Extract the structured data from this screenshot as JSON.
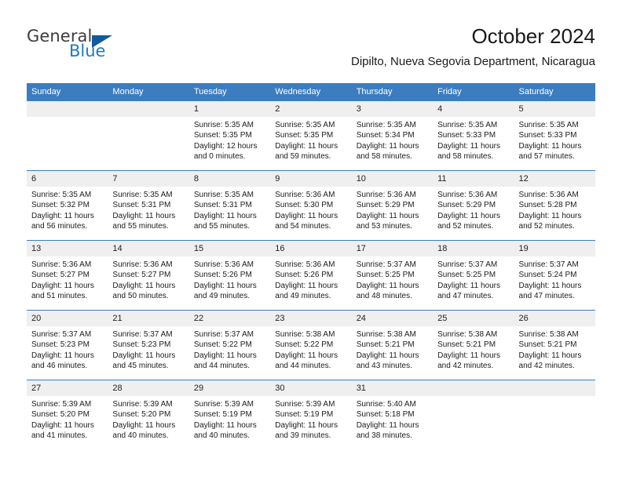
{
  "logo": {
    "word_one": "General",
    "word_two": "Blue",
    "triangle": "triangle-mark"
  },
  "header": {
    "title": "October 2024",
    "subtitle": "Dipilto, Nueva Segovia Department, Nicaragua"
  },
  "colors": {
    "header_blue": "#3c7dc0",
    "logo_blue": "#1f7ac0",
    "logo_triangle": "#125a9e",
    "daynum_band": "#efefef"
  },
  "weekday_headers": [
    "Sunday",
    "Monday",
    "Tuesday",
    "Wednesday",
    "Thursday",
    "Friday",
    "Saturday"
  ],
  "weeks": [
    [
      {
        "day": "",
        "sunrise": "",
        "sunset": "",
        "daylight": "",
        "blank": true
      },
      {
        "day": "",
        "sunrise": "",
        "sunset": "",
        "daylight": "",
        "blank": true
      },
      {
        "day": "1",
        "sunrise": "Sunrise: 5:35 AM",
        "sunset": "Sunset: 5:35 PM",
        "daylight": "Daylight: 12 hours and 0 minutes."
      },
      {
        "day": "2",
        "sunrise": "Sunrise: 5:35 AM",
        "sunset": "Sunset: 5:35 PM",
        "daylight": "Daylight: 11 hours and 59 minutes."
      },
      {
        "day": "3",
        "sunrise": "Sunrise: 5:35 AM",
        "sunset": "Sunset: 5:34 PM",
        "daylight": "Daylight: 11 hours and 58 minutes."
      },
      {
        "day": "4",
        "sunrise": "Sunrise: 5:35 AM",
        "sunset": "Sunset: 5:33 PM",
        "daylight": "Daylight: 11 hours and 58 minutes."
      },
      {
        "day": "5",
        "sunrise": "Sunrise: 5:35 AM",
        "sunset": "Sunset: 5:33 PM",
        "daylight": "Daylight: 11 hours and 57 minutes."
      }
    ],
    [
      {
        "day": "6",
        "sunrise": "Sunrise: 5:35 AM",
        "sunset": "Sunset: 5:32 PM",
        "daylight": "Daylight: 11 hours and 56 minutes."
      },
      {
        "day": "7",
        "sunrise": "Sunrise: 5:35 AM",
        "sunset": "Sunset: 5:31 PM",
        "daylight": "Daylight: 11 hours and 55 minutes."
      },
      {
        "day": "8",
        "sunrise": "Sunrise: 5:35 AM",
        "sunset": "Sunset: 5:31 PM",
        "daylight": "Daylight: 11 hours and 55 minutes."
      },
      {
        "day": "9",
        "sunrise": "Sunrise: 5:36 AM",
        "sunset": "Sunset: 5:30 PM",
        "daylight": "Daylight: 11 hours and 54 minutes."
      },
      {
        "day": "10",
        "sunrise": "Sunrise: 5:36 AM",
        "sunset": "Sunset: 5:29 PM",
        "daylight": "Daylight: 11 hours and 53 minutes."
      },
      {
        "day": "11",
        "sunrise": "Sunrise: 5:36 AM",
        "sunset": "Sunset: 5:29 PM",
        "daylight": "Daylight: 11 hours and 52 minutes."
      },
      {
        "day": "12",
        "sunrise": "Sunrise: 5:36 AM",
        "sunset": "Sunset: 5:28 PM",
        "daylight": "Daylight: 11 hours and 52 minutes."
      }
    ],
    [
      {
        "day": "13",
        "sunrise": "Sunrise: 5:36 AM",
        "sunset": "Sunset: 5:27 PM",
        "daylight": "Daylight: 11 hours and 51 minutes."
      },
      {
        "day": "14",
        "sunrise": "Sunrise: 5:36 AM",
        "sunset": "Sunset: 5:27 PM",
        "daylight": "Daylight: 11 hours and 50 minutes."
      },
      {
        "day": "15",
        "sunrise": "Sunrise: 5:36 AM",
        "sunset": "Sunset: 5:26 PM",
        "daylight": "Daylight: 11 hours and 49 minutes."
      },
      {
        "day": "16",
        "sunrise": "Sunrise: 5:36 AM",
        "sunset": "Sunset: 5:26 PM",
        "daylight": "Daylight: 11 hours and 49 minutes."
      },
      {
        "day": "17",
        "sunrise": "Sunrise: 5:37 AM",
        "sunset": "Sunset: 5:25 PM",
        "daylight": "Daylight: 11 hours and 48 minutes."
      },
      {
        "day": "18",
        "sunrise": "Sunrise: 5:37 AM",
        "sunset": "Sunset: 5:25 PM",
        "daylight": "Daylight: 11 hours and 47 minutes."
      },
      {
        "day": "19",
        "sunrise": "Sunrise: 5:37 AM",
        "sunset": "Sunset: 5:24 PM",
        "daylight": "Daylight: 11 hours and 47 minutes."
      }
    ],
    [
      {
        "day": "20",
        "sunrise": "Sunrise: 5:37 AM",
        "sunset": "Sunset: 5:23 PM",
        "daylight": "Daylight: 11 hours and 46 minutes."
      },
      {
        "day": "21",
        "sunrise": "Sunrise: 5:37 AM",
        "sunset": "Sunset: 5:23 PM",
        "daylight": "Daylight: 11 hours and 45 minutes."
      },
      {
        "day": "22",
        "sunrise": "Sunrise: 5:37 AM",
        "sunset": "Sunset: 5:22 PM",
        "daylight": "Daylight: 11 hours and 44 minutes."
      },
      {
        "day": "23",
        "sunrise": "Sunrise: 5:38 AM",
        "sunset": "Sunset: 5:22 PM",
        "daylight": "Daylight: 11 hours and 44 minutes."
      },
      {
        "day": "24",
        "sunrise": "Sunrise: 5:38 AM",
        "sunset": "Sunset: 5:21 PM",
        "daylight": "Daylight: 11 hours and 43 minutes."
      },
      {
        "day": "25",
        "sunrise": "Sunrise: 5:38 AM",
        "sunset": "Sunset: 5:21 PM",
        "daylight": "Daylight: 11 hours and 42 minutes."
      },
      {
        "day": "26",
        "sunrise": "Sunrise: 5:38 AM",
        "sunset": "Sunset: 5:21 PM",
        "daylight": "Daylight: 11 hours and 42 minutes."
      }
    ],
    [
      {
        "day": "27",
        "sunrise": "Sunrise: 5:39 AM",
        "sunset": "Sunset: 5:20 PM",
        "daylight": "Daylight: 11 hours and 41 minutes."
      },
      {
        "day": "28",
        "sunrise": "Sunrise: 5:39 AM",
        "sunset": "Sunset: 5:20 PM",
        "daylight": "Daylight: 11 hours and 40 minutes."
      },
      {
        "day": "29",
        "sunrise": "Sunrise: 5:39 AM",
        "sunset": "Sunset: 5:19 PM",
        "daylight": "Daylight: 11 hours and 40 minutes."
      },
      {
        "day": "30",
        "sunrise": "Sunrise: 5:39 AM",
        "sunset": "Sunset: 5:19 PM",
        "daylight": "Daylight: 11 hours and 39 minutes."
      },
      {
        "day": "31",
        "sunrise": "Sunrise: 5:40 AM",
        "sunset": "Sunset: 5:18 PM",
        "daylight": "Daylight: 11 hours and 38 minutes."
      },
      {
        "day": "",
        "sunrise": "",
        "sunset": "",
        "daylight": "",
        "blank": true
      },
      {
        "day": "",
        "sunrise": "",
        "sunset": "",
        "daylight": "",
        "blank": true
      }
    ]
  ]
}
